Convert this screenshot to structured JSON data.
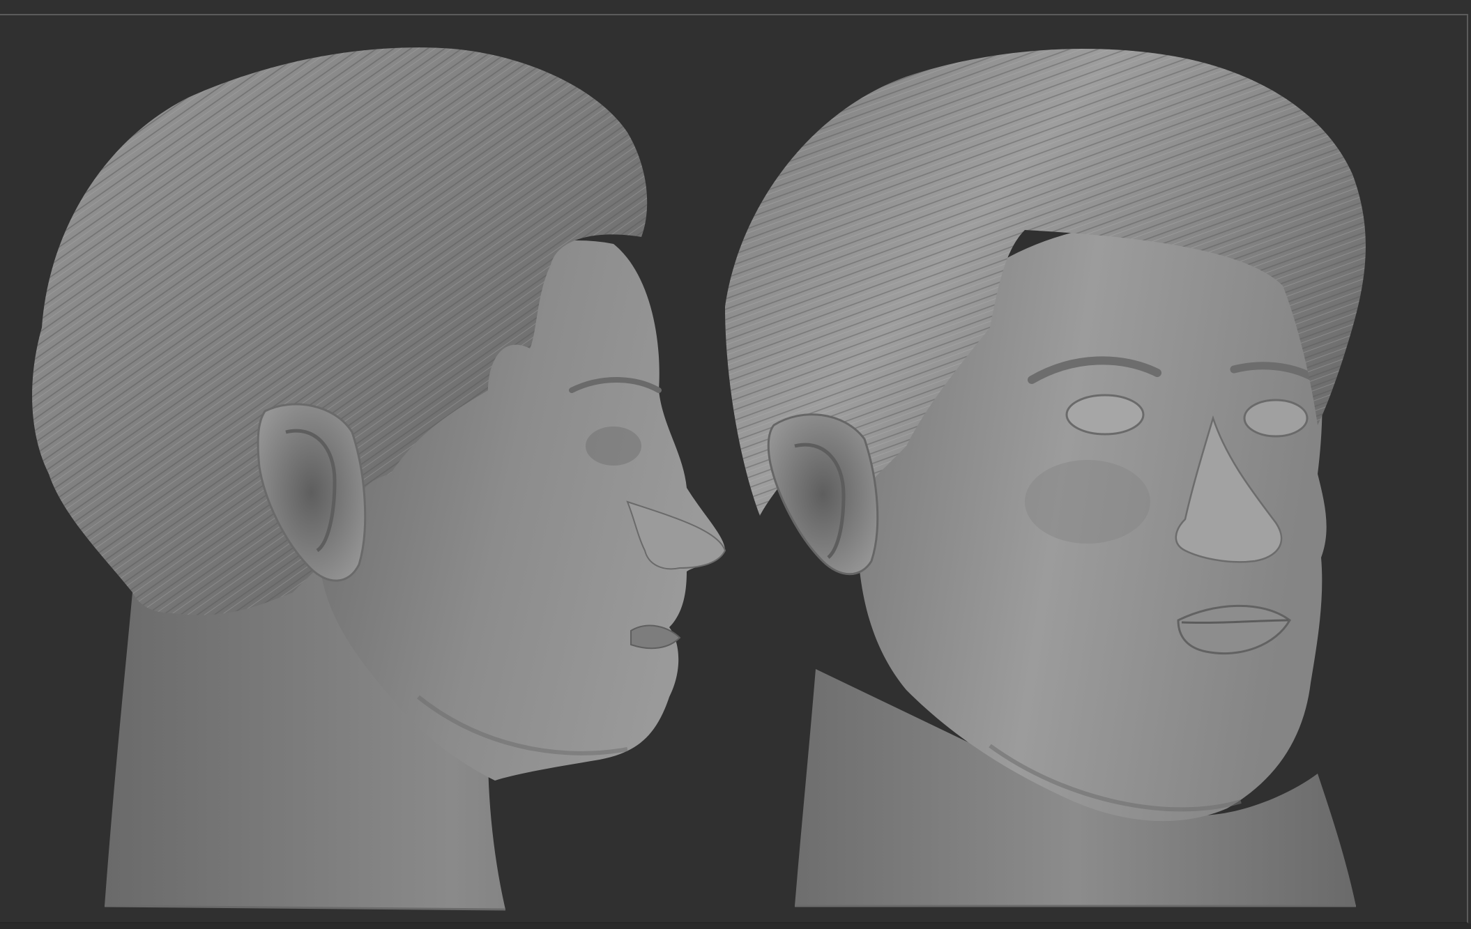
{
  "viewport": {
    "background": "#303030",
    "frame_color": "#5b5b5b"
  },
  "models": [
    {
      "view": "profile",
      "material": "clay",
      "base_color": "#8a8a8a"
    },
    {
      "view": "three-quarter",
      "material": "clay",
      "base_color": "#8f8f8f"
    }
  ]
}
